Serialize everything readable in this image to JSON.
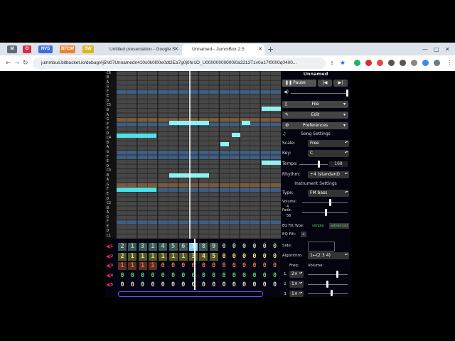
{
  "browser": {
    "bookmarks": [
      {
        "label": "M",
        "color": "#5f6b78"
      },
      {
        "label": "O",
        "color": "#d1334a"
      },
      {
        "label": "NVS",
        "color": "#3f6fd8"
      },
      {
        "label": "BFCW",
        "color": "#e8862e"
      },
      {
        "label": "SW",
        "color": "#e0b21e"
      }
    ],
    "tabs": [
      {
        "title": "Untitled presentation - Google S",
        "active": false
      },
      {
        "title": "Unnamed - JummBox 2.5",
        "active": true
      }
    ],
    "url": "jummbus.bitbucket.io/debug/#j5N07Unnamedn410s0k0l00e0dt2Ea7g0j0hr1O_U00000000000i0a3213T1v0u17f0000q0400..."
  },
  "app": {
    "piano_keys": [
      "C6",
      "B",
      "A",
      "G",
      "F",
      "E",
      "D",
      "C5",
      "B",
      "A",
      "G",
      "F",
      "E",
      "D",
      "C4",
      "B",
      "A",
      "G",
      "F",
      "E",
      "D",
      "C3",
      "B",
      "A",
      "G",
      "F",
      "E",
      "D",
      "C2",
      "B",
      "A",
      "G",
      "F",
      "E",
      "D",
      "C1"
    ],
    "song": {
      "title": "Unnamed",
      "pause_label": "Pause",
      "file_label": "File",
      "edit_label": "Edit",
      "preferences_label": "Preferences",
      "song_settings_label": "Song Settings",
      "scale_label": "Scale:",
      "scale_value": "Free",
      "key_label": "Key:",
      "key_value": "C",
      "tempo_label": "Tempo:",
      "tempo_value": "168",
      "rhythm_label": "Rhythm:",
      "rhythm_value": "÷4 (standard)"
    },
    "instrument": {
      "instrument_settings_label": "Instrument Settings",
      "type_label": "Type:",
      "type_value": "FM bass",
      "volume_label": "Volume:",
      "fadespeed_label": "Fade:",
      "fadespeed_values": [
        "4",
        "56"
      ],
      "eq_type_label": "EQ Filt.Type:",
      "eq_simple": "simple",
      "eq_advanced": "advanced",
      "eq_filt_label": "EQ Filt:",
      "side_label": "Side:",
      "algorithm_label": "Algorithm:",
      "algorithm_value": "1←(2 3 4)",
      "freq_label": "Freq:",
      "op_volume_label": "Volume:",
      "operators": [
        {
          "num": "1.",
          "freq": "2×"
        },
        {
          "num": "2.",
          "freq": "1×"
        },
        {
          "num": "3.",
          "freq": "1×"
        }
      ]
    },
    "tracks": [
      {
        "num": "1",
        "color": "#a8c8c0",
        "bg": "#3d5a56",
        "cells": [
          "2",
          "1",
          "3",
          "1",
          "4",
          "5",
          "6",
          "7",
          "8",
          "9",
          "0",
          "0",
          "0",
          "0",
          "0",
          "0"
        ]
      },
      {
        "num": "2",
        "color": "#e2e27a",
        "bg": "#55552a",
        "cells": [
          "2",
          "1",
          "1",
          "1",
          "1",
          "1",
          "1",
          "3",
          "4",
          "5",
          "0",
          "0",
          "0",
          "0",
          "0",
          "0"
        ]
      },
      {
        "num": "3",
        "color": "#e0704f",
        "bg": "#5a2e22",
        "cells": [
          "1",
          "1",
          "1",
          "1",
          "0",
          "0",
          "0",
          "0",
          "0",
          "0",
          "0",
          "0",
          "0",
          "0",
          "0",
          "0"
        ]
      },
      {
        "num": "4",
        "color": "#58c873",
        "bg": "#040410",
        "cells": [
          "0",
          "0",
          "0",
          "0",
          "0",
          "0",
          "0",
          "0",
          "0",
          "0",
          "0",
          "0",
          "0",
          "0",
          "0",
          "0"
        ]
      },
      {
        "num": "5",
        "color": "#d8d8d8",
        "bg": "#040410",
        "cells": [
          "0",
          "0",
          "0",
          "0",
          "0",
          "0",
          "0",
          "0",
          "0",
          "0",
          "0",
          "0",
          "0",
          "0",
          "0",
          "0"
        ]
      }
    ]
  }
}
